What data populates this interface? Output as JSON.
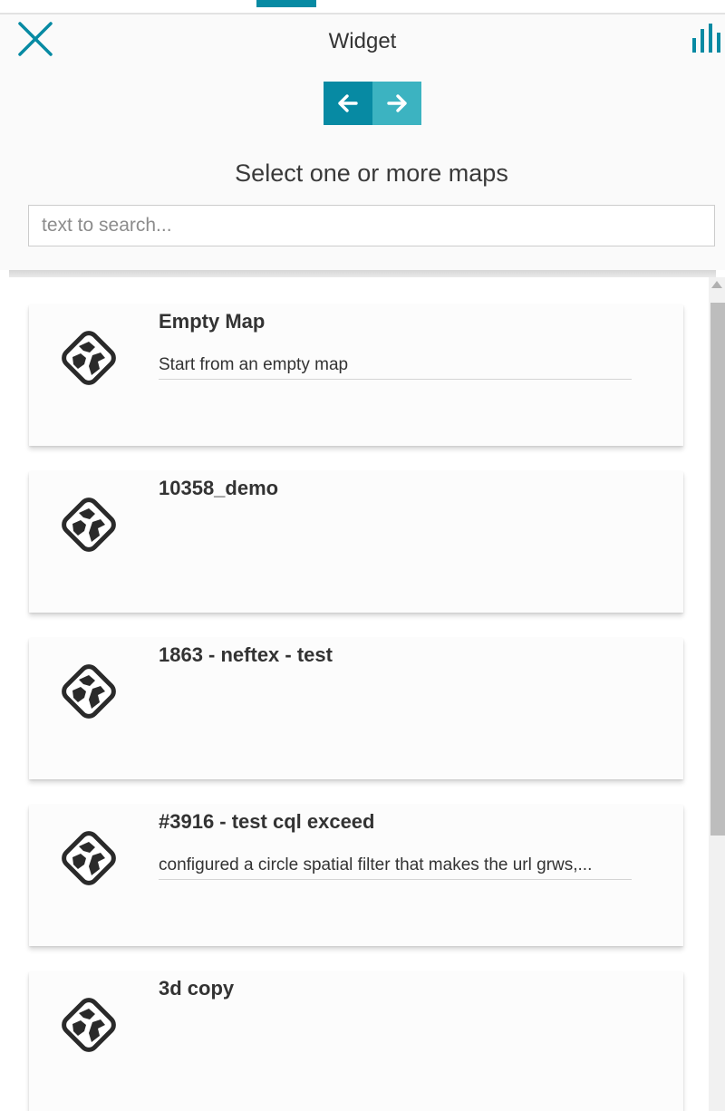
{
  "header": {
    "title": "Widget",
    "close_icon": "close-icon",
    "chart_icon": "bar-chart-icon",
    "prev_icon": "arrow-left-icon",
    "next_icon": "arrow-right-icon",
    "accent_color": "#078aa3",
    "accent_light_color": "#3cb3c1"
  },
  "main": {
    "section_title": "Select one or more maps",
    "search": {
      "placeholder": "text to search...",
      "value": ""
    },
    "maps": [
      {
        "title": "Empty Map",
        "description": "Start from an empty map",
        "icon": "map-icon"
      },
      {
        "title": "10358_demo",
        "description": "",
        "icon": "map-icon"
      },
      {
        "title": "1863 - neftex - test",
        "description": "",
        "icon": "map-icon"
      },
      {
        "title": "#3916 - test cql exceed",
        "description": "configured a circle spatial filter that makes the url grws,...",
        "icon": "map-icon"
      },
      {
        "title": "3d copy",
        "description": "",
        "icon": "map-icon"
      }
    ]
  }
}
